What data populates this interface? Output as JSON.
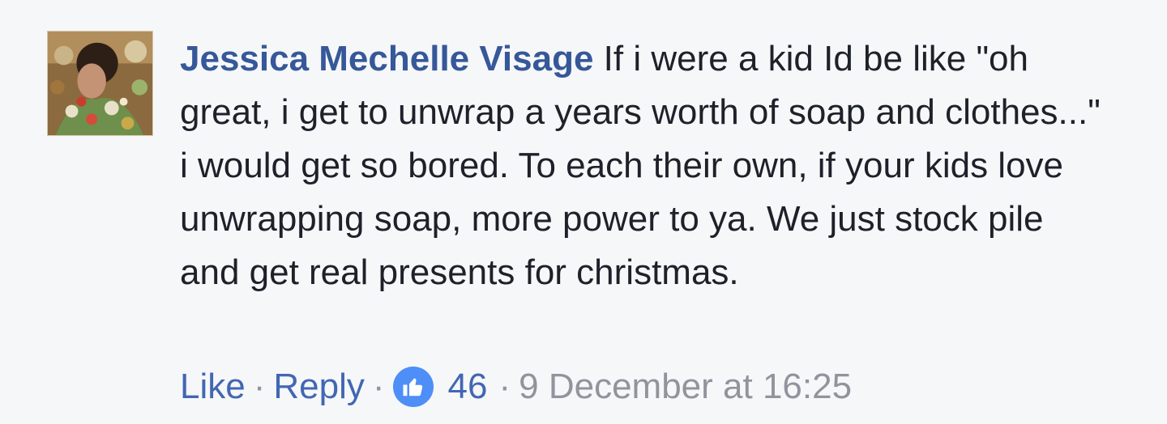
{
  "comment": {
    "author": "Jessica Mechelle Visage",
    "text": "If i were a kid Id be like \"oh great, i get to unwrap a years worth of soap and clothes...\" i would get so bored. To each their own, if your kids love unwrapping soap, more power to ya. We just stock pile and get real presents for christmas.",
    "avatar_icon": "user-photo",
    "actions": {
      "like_label": "Like",
      "reply_label": "Reply",
      "separator": "·",
      "reaction_icon": "thumbs-up-icon",
      "reaction_count": "46",
      "timestamp": "9 December at 16:25"
    }
  },
  "colors": {
    "author": "#365899",
    "link": "#4267b2",
    "meta": "#90949c",
    "reaction": "#4e8ef7",
    "background": "#f6f7f9"
  }
}
